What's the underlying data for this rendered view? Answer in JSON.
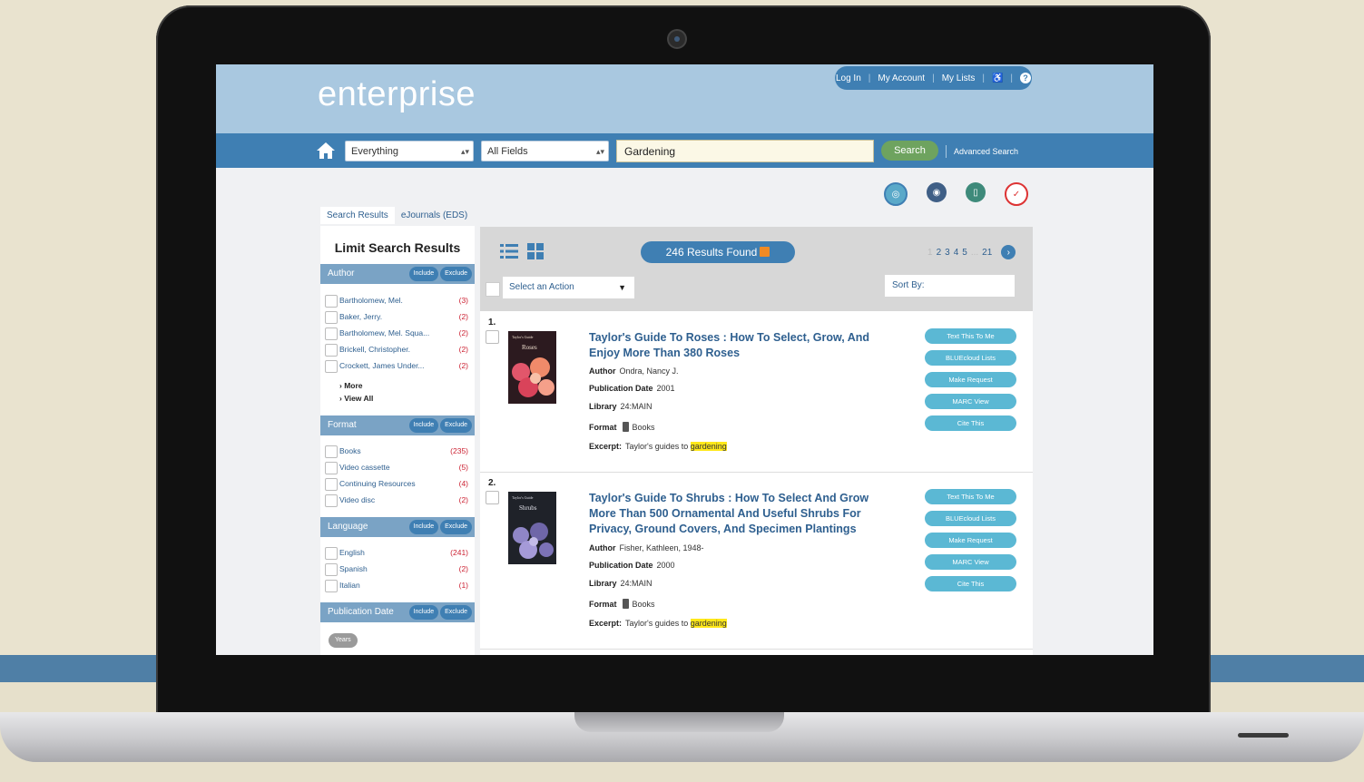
{
  "header": {
    "logo": "enterprise",
    "utility_links": [
      "Log In",
      "My Account",
      "My Lists"
    ],
    "help_label": "?"
  },
  "search": {
    "scope": "Everything",
    "field": "All Fields",
    "query": "Gardening",
    "button": "Search",
    "advanced": "Advanced Search"
  },
  "tabs": [
    "Search Results",
    "eJournals (EDS)"
  ],
  "sidebar": {
    "title": "Limit Search Results",
    "include_label": "Include",
    "exclude_label": "Exclude",
    "facets": [
      {
        "name": "Author",
        "items": [
          {
            "label": "Bartholomew, Mel.",
            "count": "(3)"
          },
          {
            "label": "Baker, Jerry.",
            "count": "(2)"
          },
          {
            "label": "Bartholomew, Mel. Squa...",
            "count": "(2)"
          },
          {
            "label": "Brickell, Christopher.",
            "count": "(2)"
          },
          {
            "label": "Crockett, James Under...",
            "count": "(2)"
          }
        ]
      },
      {
        "name": "Format",
        "items": [
          {
            "label": "Books",
            "count": "(235)"
          },
          {
            "label": "Video cassette",
            "count": "(5)"
          },
          {
            "label": "Continuing Resources",
            "count": "(4)"
          },
          {
            "label": "Video disc",
            "count": "(2)"
          }
        ]
      },
      {
        "name": "Language",
        "items": [
          {
            "label": "English",
            "count": "(241)"
          },
          {
            "label": "Spanish",
            "count": "(2)"
          },
          {
            "label": "Italian",
            "count": "(1)"
          }
        ]
      },
      {
        "name": "Publication Date",
        "items": []
      }
    ],
    "more": "More",
    "view_all": "View All",
    "years": "Years"
  },
  "results": {
    "found": "246 Results Found",
    "pages": [
      "1",
      "2",
      "3",
      "4",
      "5",
      "...",
      "21"
    ],
    "action": "Select an Action",
    "sort": "Sort By:",
    "records": [
      {
        "num": "1.",
        "cover_title": "Roses",
        "cover_series": "Taylor's Guide",
        "title": "Taylor's Guide To Roses : How To Select, Grow, And Enjoy More Than 380 Roses",
        "author": "Ondra, Nancy J.",
        "pub_date": "2001",
        "library": "24:MAIN",
        "format": "Books",
        "excerpt_prefix": "Taylor's guides to ",
        "excerpt_hl": "gardening"
      },
      {
        "num": "2.",
        "cover_title": "Shrubs",
        "cover_series": "Taylor's Guide",
        "title": "Taylor's Guide To Shrubs : How To Select And Grow More Than 500 Ornamental And Useful Shrubs For Privacy, Ground Covers, And Specimen Plantings",
        "author": "Fisher, Kathleen, 1948-",
        "pub_date": "2000",
        "library": "24:MAIN",
        "format": "Books",
        "excerpt_prefix": "Taylor's guides to ",
        "excerpt_hl": "gardening"
      }
    ],
    "labels": {
      "author": "Author",
      "pub_date": "Publication Date",
      "library": "Library",
      "format": "Format",
      "excerpt": "Excerpt:"
    },
    "record_actions": [
      "Text This To Me",
      "BLUEcloud Lists",
      "Make Request",
      "MARC View",
      "Cite This"
    ]
  },
  "colors": {
    "header_bg": "#a9c8e0",
    "nav_bg": "#3f7fb3",
    "accent_green": "#6ea35f",
    "action_button": "#5bb8d4",
    "link": "#2e5f8f",
    "highlight": "#ffe81a"
  },
  "icons": [
    "home-icon",
    "list-view-icon",
    "grid-view-icon",
    "rss-icon",
    "accessibility-icon",
    "help-icon",
    "overdrive-icon",
    "audiobook-icon",
    "ebook-icon",
    "checklist-icon",
    "next-page-icon",
    "book-format-icon"
  ]
}
